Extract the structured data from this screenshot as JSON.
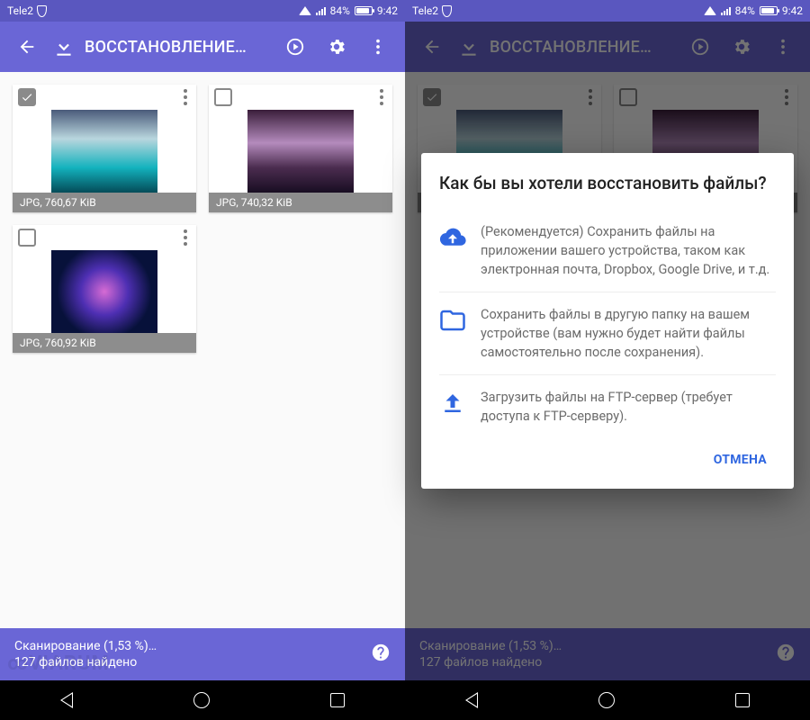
{
  "status": {
    "carrier": "Tele2",
    "battery_pct": "84%",
    "time": "9:42"
  },
  "appbar": {
    "title": "ВОССТАНОВЛЕНИЕ…"
  },
  "cards": [
    {
      "label": "JPG, 760,67 KiB",
      "checked": true
    },
    {
      "label": "JPG, 740,32 KiB",
      "checked": false
    },
    {
      "label": "JPG, 760,92 KiB",
      "checked": false
    }
  ],
  "scan": {
    "line1": "Сканирование (1,53 %)…",
    "line2": "127 файлов найдено"
  },
  "watermark": "∞VIARUM",
  "dialog": {
    "title": "Как бы вы хотели восстановить файлы?",
    "opt1": "(Рекомендуется) Сохранить файлы на приложении вашего устройства, таком как электронная почта, Dropbox, Google Drive, и т.д.",
    "opt2": "Сохранить файлы в другую папку на вашем устройстве (вам нужно будет найти файлы самостоятельно после сохранения).",
    "opt3": "Загрузить файлы на FTP-сервер (требует доступа к FTP-серверу).",
    "cancel": "ОТМЕНА"
  }
}
